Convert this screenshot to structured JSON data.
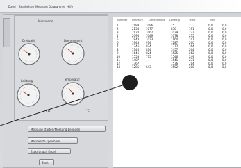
{
  "menu": [
    "Datei",
    "Bearbeiten",
    "Messung",
    "Diagramme",
    "Hilfe"
  ],
  "panel": {
    "title": "Messwerte"
  },
  "gauges": [
    {
      "label": "Drehzahl",
      "foot": ""
    },
    {
      "label": "Drehmoment",
      "foot": ""
    },
    {
      "label": "Leistung",
      "foot": "kW"
    },
    {
      "label": "Temperatur",
      "foot": "°C"
    }
  ],
  "buttons": {
    "start": "Messung starten/Messung beenden",
    "save": "Messwerte speichern",
    "export": "Export nach Excel",
    "small": "Start"
  },
  "table": {
    "columns": [
      "Nummer",
      "Drehzahl",
      "Drehmoment",
      "Leistung",
      "Temp",
      "Zeit"
    ],
    "rows": [
      [
        "1",
        "2198",
        "1096",
        "15",
        "2",
        "0,0",
        "0,0"
      ],
      [
        "2",
        "2154",
        "1077",
        "856",
        "191",
        "0,0",
        "0,0"
      ],
      [
        "3",
        "2124",
        "1062",
        "1029",
        "227",
        "0,0",
        "0,0"
      ],
      [
        "4",
        "2098",
        "1049",
        "1078",
        "235",
        "0,0",
        "0,0"
      ],
      [
        "5",
        "1948",
        "1023",
        "1164",
        "247",
        "0,0",
        "0,0"
      ],
      [
        "6",
        "1948",
        "974",
        "1287",
        "260",
        "0,0",
        "0,0"
      ],
      [
        "7",
        "1746",
        "924",
        "1377",
        "264",
        "0,0",
        "0,0"
      ],
      [
        "8",
        "1746",
        "874",
        "1457",
        "264",
        "0,0",
        "0,0"
      ],
      [
        "9",
        "1646",
        "824",
        "1525",
        "262",
        "0,0",
        "0,0"
      ],
      [
        "10",
        "1553",
        "775",
        "1546",
        "249",
        "0,0",
        "0,0"
      ],
      [
        "11",
        "1487",
        "",
        "1541",
        "231",
        "0,0",
        "0,0"
      ],
      [
        "12",
        "1367",
        "",
        "1536",
        "214",
        "0,0",
        "0,0"
      ],
      [
        "13",
        "1285",
        "643",
        "1502",
        "200",
        "0,0",
        "0,0"
      ]
    ]
  }
}
